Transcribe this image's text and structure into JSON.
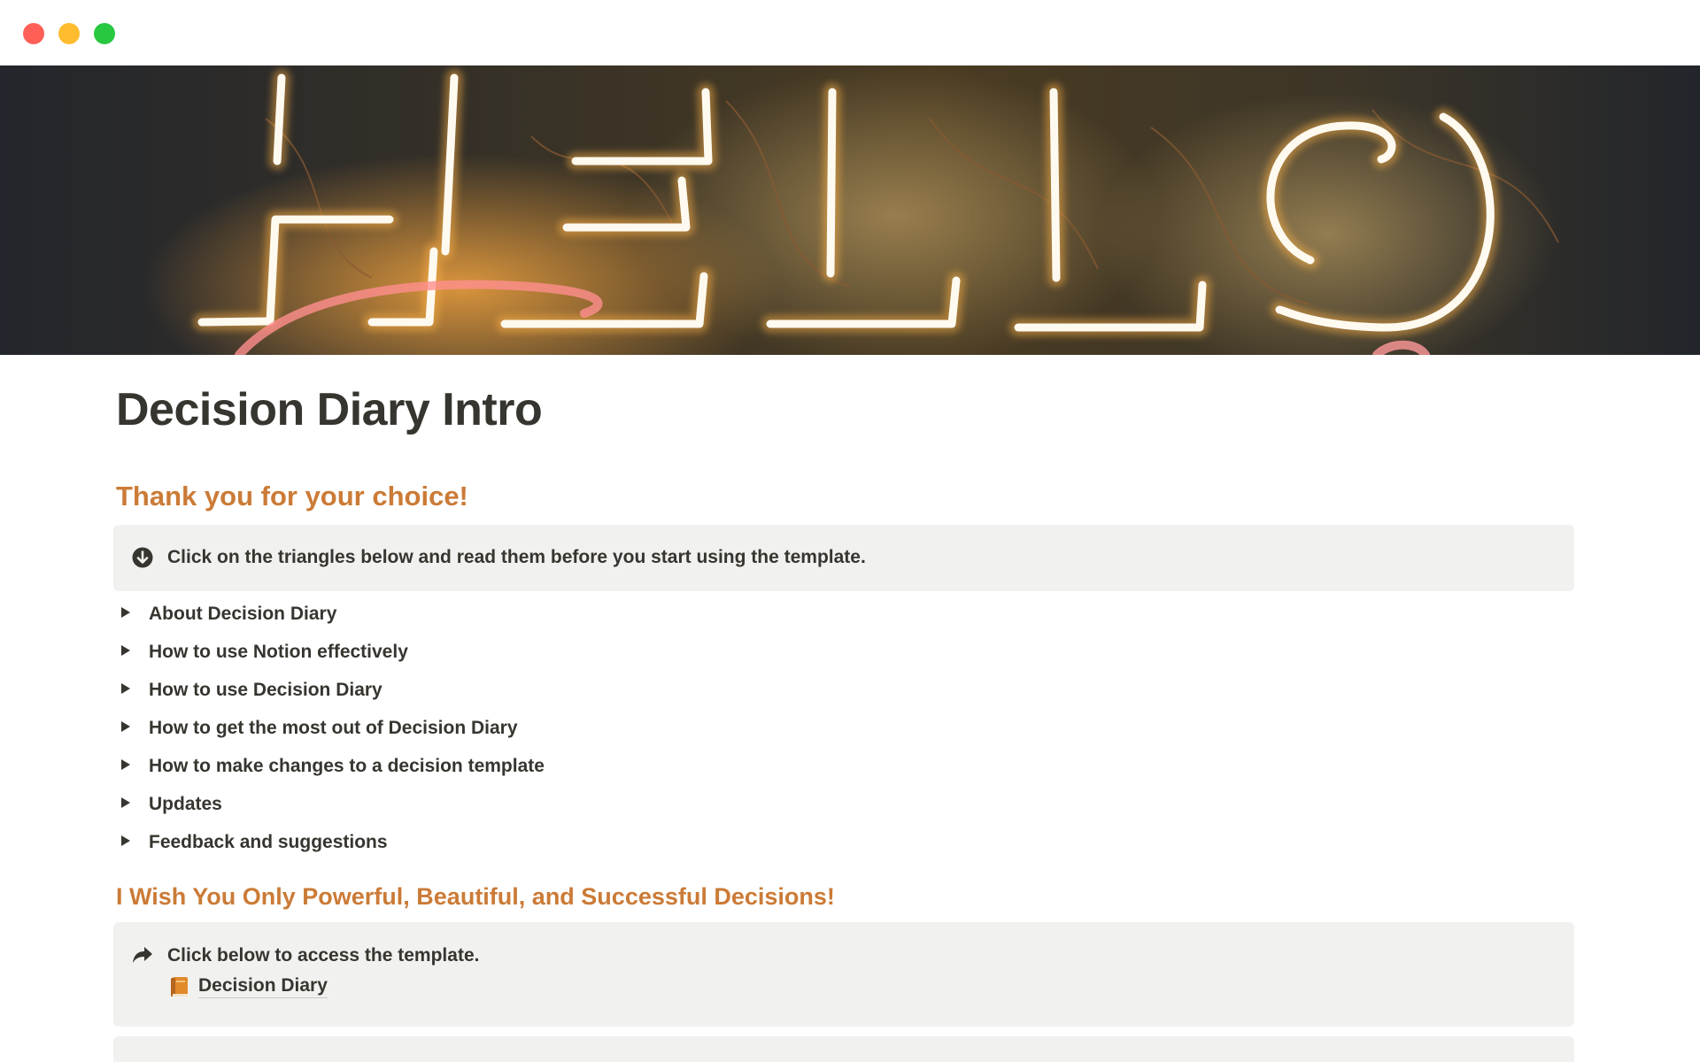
{
  "window": {
    "controls": [
      "close",
      "minimize",
      "maximize"
    ]
  },
  "cover": {
    "text": "HELLO",
    "description_colors": {
      "background": "#2a2d33",
      "neon": "#fff6d8",
      "glow": "#f4a83a",
      "pink": "#ff7a7a"
    }
  },
  "page": {
    "title": "Decision Diary Intro"
  },
  "section1": {
    "heading": "Thank you for your choice!",
    "callout": {
      "icon": "arrow-down-circle-icon",
      "text": "Click on the triangles below and read them before you start using the template."
    },
    "toggles": [
      {
        "label": "About Decision Diary"
      },
      {
        "label": "How to use Notion effectively"
      },
      {
        "label": "How to use Decision Diary"
      },
      {
        "label": "How to get the most out of Decision Diary"
      },
      {
        "label": "How to make changes to a decision template"
      },
      {
        "label": "Updates"
      },
      {
        "label": "Feedback and suggestions"
      }
    ]
  },
  "section2": {
    "heading": "I Wish You Only Powerful, Beautiful, and Successful Decisions!",
    "callout": {
      "icon": "share-arrow-icon",
      "text": "Click below to access the template.",
      "link": {
        "icon": "book-icon",
        "label": "Decision Diary"
      }
    }
  },
  "colors": {
    "heading_accent": "#cb7b37",
    "text": "#37352f",
    "callout_bg": "#f1f1ef"
  }
}
